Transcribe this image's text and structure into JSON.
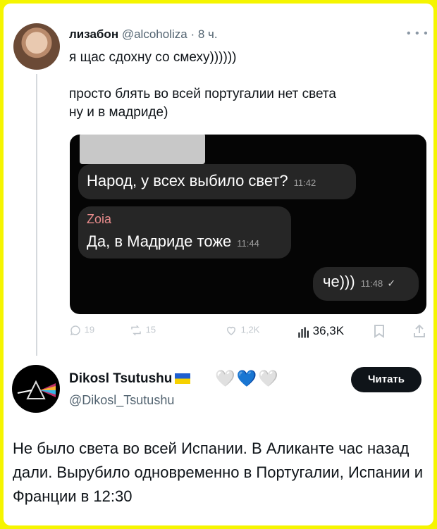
{
  "tweet1": {
    "display_name": "лизабон",
    "handle": "@alcoholiza",
    "separator": "·",
    "time": "8 ч.",
    "text": "я щас сдохну со смеху))))))\n\nпросто блять во всей португалии нет света\nну и в мадриде)",
    "more_icon": "more-dots-icon"
  },
  "chat": {
    "messages": [
      {
        "text": "Народ, у всех выбило свет?",
        "time": "11:42"
      },
      {
        "sender": "Zoia",
        "text": "Да, в Мадриде тоже",
        "time": "11:44"
      },
      {
        "text": "че)))",
        "time": "11:48",
        "status_icon": "check-icon"
      }
    ]
  },
  "actions": {
    "replies": "19",
    "reposts": "15",
    "likes": "1,2K",
    "views": "36,3K"
  },
  "tweet2": {
    "display_name": "Dikosl Tsutushu",
    "handle": "@Dikosl_Tsutushu",
    "emoji": [
      "🤍",
      "💙",
      "🤍"
    ],
    "follow_label": "Читать",
    "text": "Не было света во всей Испании. В Аликанте час назад дали. Вырубило одновременно в Португалии, Испании и Франции в 12:30"
  },
  "colors": {
    "frame": "#f5f500",
    "text": "#0f1419",
    "secondary": "#536471",
    "bubble": "#262626",
    "sender": "#e78b8b"
  }
}
